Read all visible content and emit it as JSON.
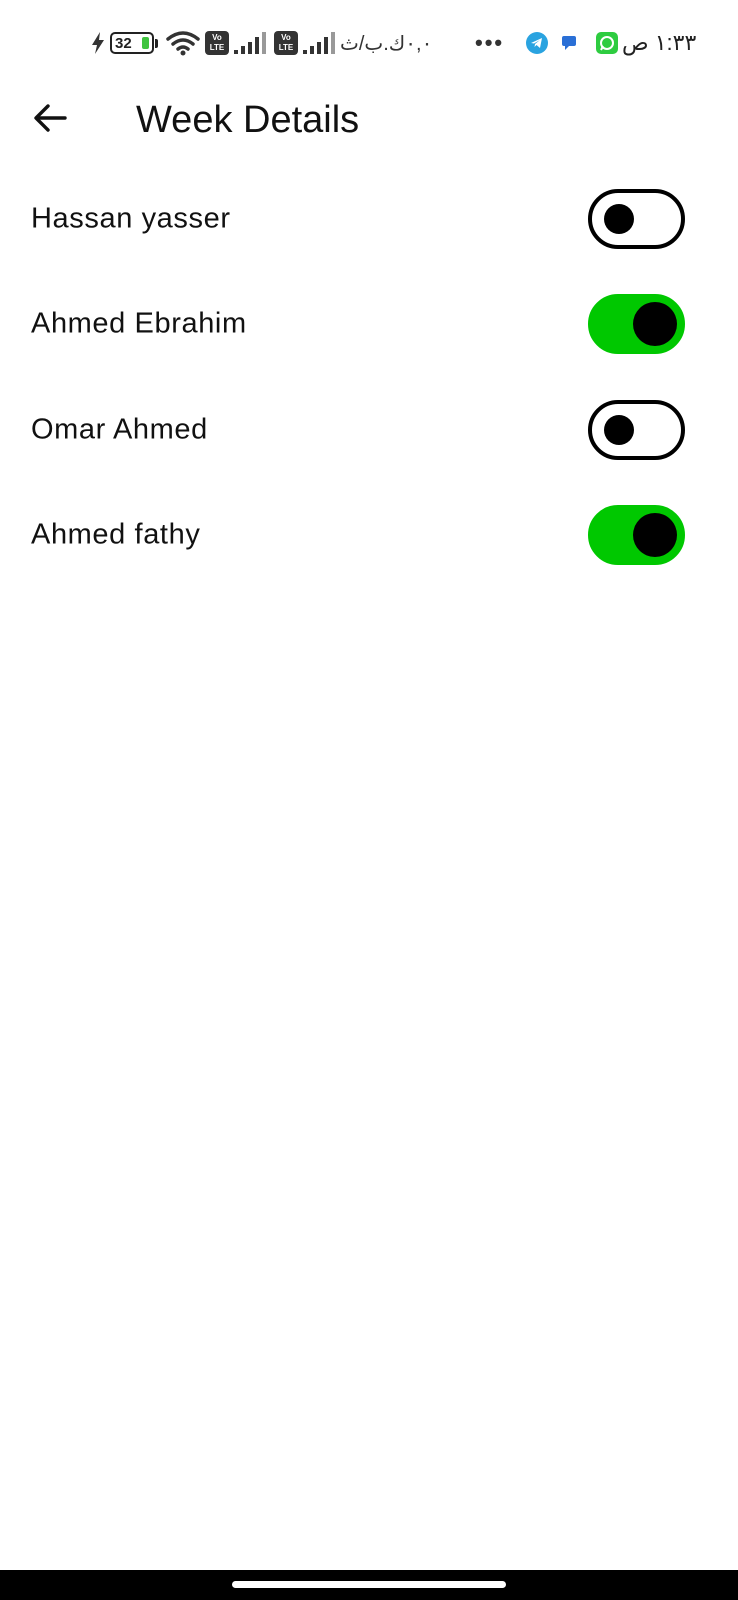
{
  "status_bar": {
    "time": "١:٣٣ ص",
    "network_text": "٠,٠ك.ب/ث",
    "battery_level": "32",
    "more_icons": "•••",
    "volte_label": "Vo LTE",
    "icons": [
      "charging-icon",
      "battery-icon",
      "wifi-icon",
      "volte-icon",
      "signal-icon",
      "telegram-icon",
      "message-icon",
      "whatsapp-icon"
    ]
  },
  "app_bar": {
    "title": "Week Details",
    "back_icon": "arrow-back-icon"
  },
  "members": [
    {
      "name": "Hassan yasser",
      "enabled": false
    },
    {
      "name": "Ahmed Ebrahim",
      "enabled": true
    },
    {
      "name": "Omar Ahmed",
      "enabled": false
    },
    {
      "name": "Ahmed fathy",
      "enabled": true
    }
  ],
  "colors": {
    "switch_on": "#00c800",
    "switch_knob": "#000000",
    "background": "#ffffff",
    "text": "#111111"
  }
}
